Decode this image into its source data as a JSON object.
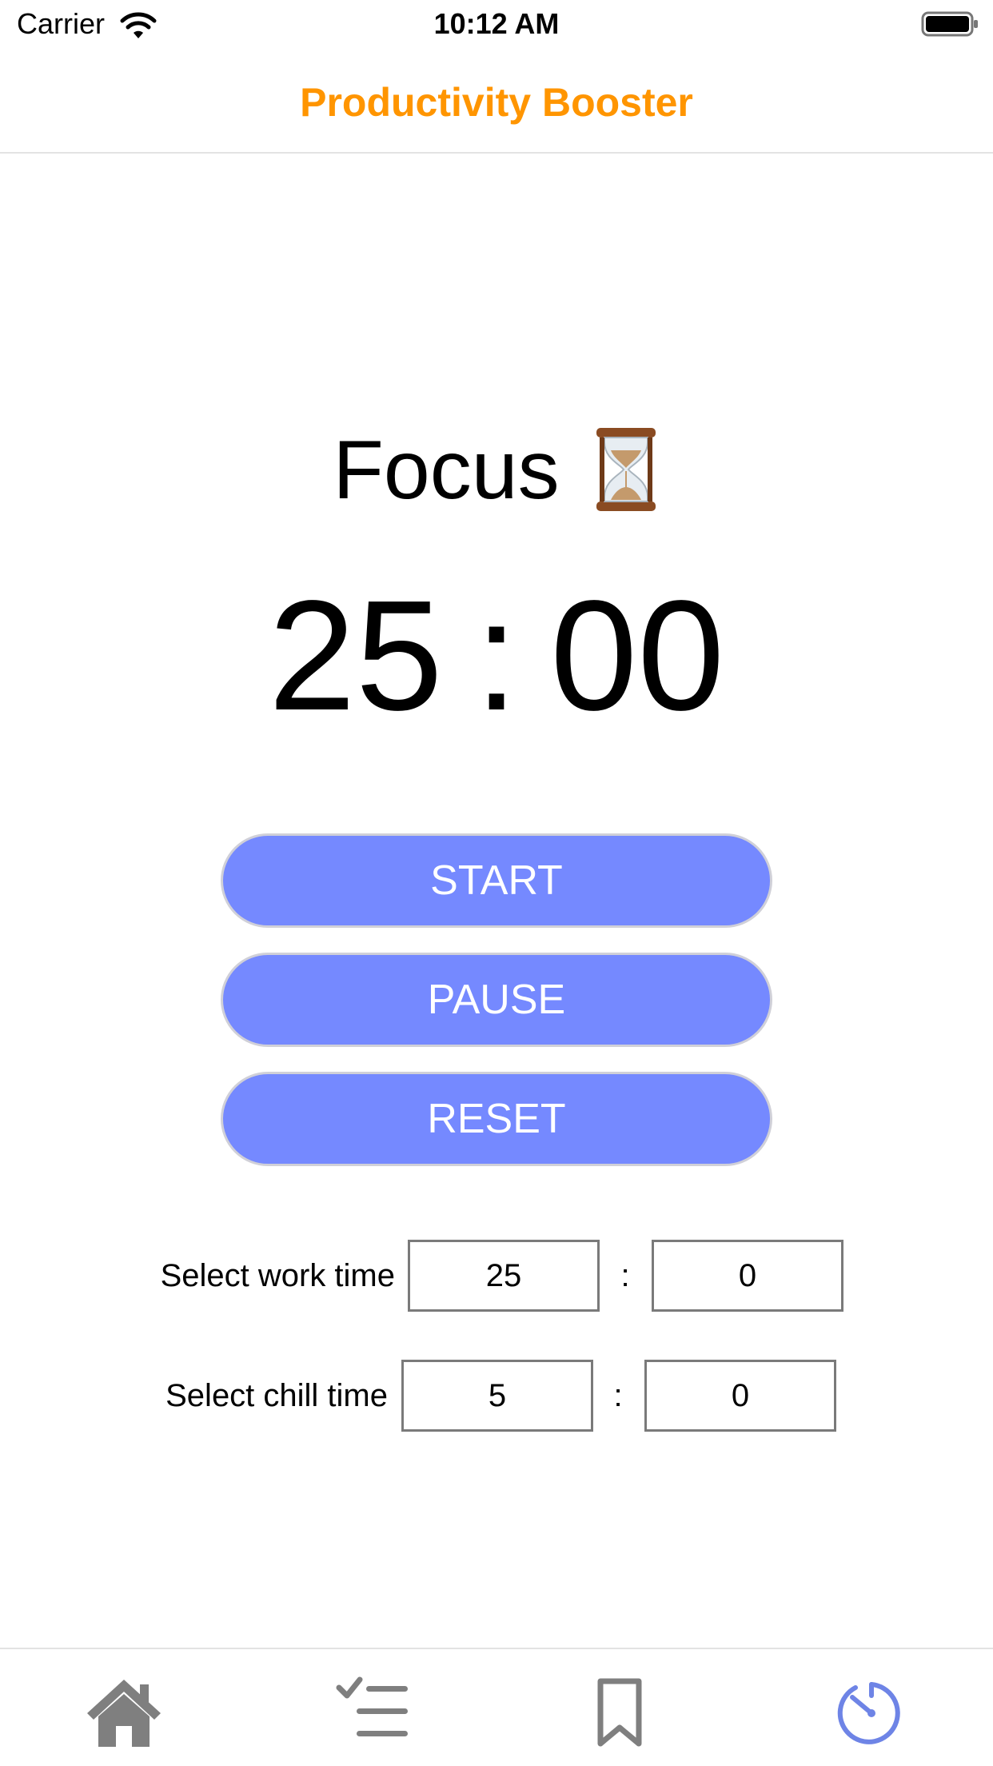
{
  "status_bar": {
    "carrier": "Carrier",
    "time": "10:12 AM"
  },
  "nav": {
    "title": "Productivity Booster"
  },
  "timer": {
    "mode_label": "Focus",
    "mode_icon": "hourglass-icon",
    "minutes": "25",
    "colon": ":",
    "seconds": "00"
  },
  "buttons": {
    "start": "START",
    "pause": "PAUSE",
    "reset": "RESET"
  },
  "settings": {
    "work": {
      "label": "Select work time",
      "minutes": "25",
      "separator": ":",
      "seconds": "0"
    },
    "chill": {
      "label": "Select chill time",
      "minutes": "5",
      "separator": ":",
      "seconds": "0"
    }
  },
  "tab_bar": {
    "tabs": [
      {
        "icon": "home-icon",
        "active": false
      },
      {
        "icon": "checklist-icon",
        "active": false
      },
      {
        "icon": "bookmark-icon",
        "active": false
      },
      {
        "icon": "timer-icon",
        "active": true
      }
    ]
  },
  "colors": {
    "accent": "#ff9500",
    "button": "#7589ff",
    "tab_active": "#6e84e6",
    "tab_inactive": "#7f7f7f"
  }
}
